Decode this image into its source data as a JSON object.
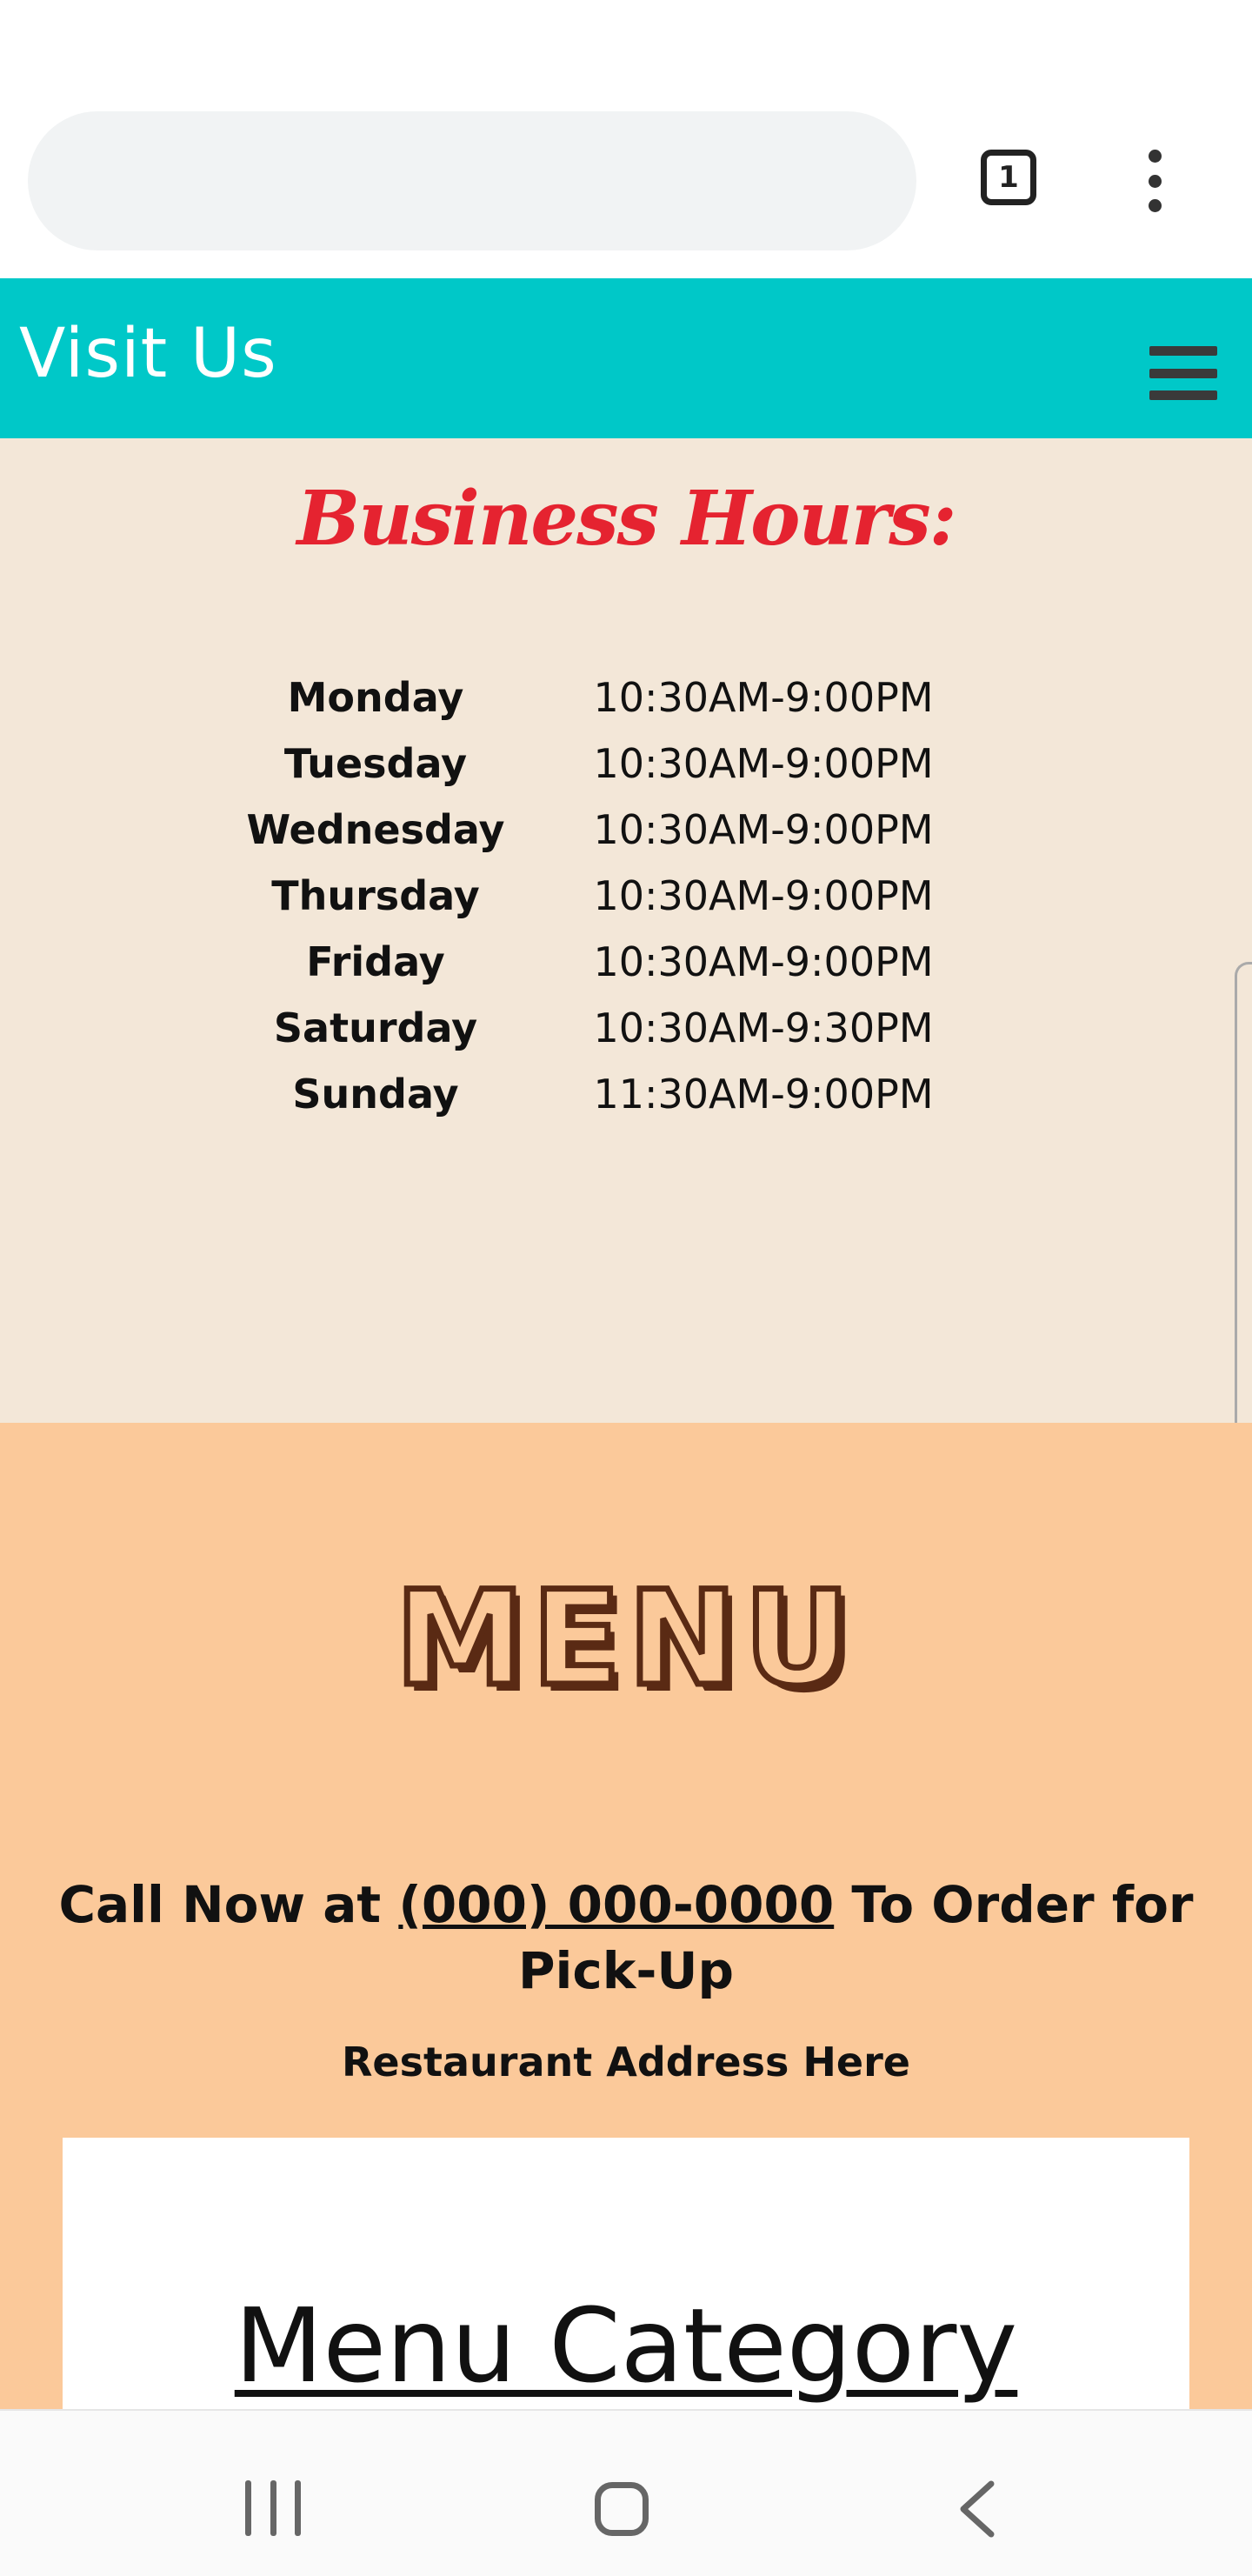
{
  "browser": {
    "tab_count": "1",
    "icons": {
      "tabs": "tab-switcher-icon",
      "menu": "more-vert-icon"
    }
  },
  "header": {
    "title": "Visit Us",
    "menu_icon": "hamburger-icon",
    "bg_color": "#00c8c8"
  },
  "hours": {
    "title": "Business Hours:",
    "title_color": "#e52330",
    "rows": [
      {
        "day": "Monday",
        "time": "10:30AM-9:00PM"
      },
      {
        "day": "Tuesday",
        "time": "10:30AM-9:00PM"
      },
      {
        "day": "Wednesday",
        "time": "10:30AM-9:00PM"
      },
      {
        "day": "Thursday",
        "time": "10:30AM-9:00PM"
      },
      {
        "day": "Friday",
        "time": "10:30AM-9:00PM"
      },
      {
        "day": "Saturday",
        "time": "10:30AM-9:30PM"
      },
      {
        "day": "Sunday",
        "time": "11:30AM-9:00PM"
      }
    ]
  },
  "menu": {
    "heading": "MENU",
    "heading_color": "#5a2a14",
    "call_prefix": "Call Now at ",
    "phone": "(000) 000-0000",
    "call_suffix": " To Order for Pick-Up",
    "address": "Restaurant Address Here",
    "category_title": "Menu Category"
  },
  "android_nav": {
    "icons": {
      "recents": "recents-icon",
      "home": "home-icon",
      "back": "back-icon"
    }
  }
}
